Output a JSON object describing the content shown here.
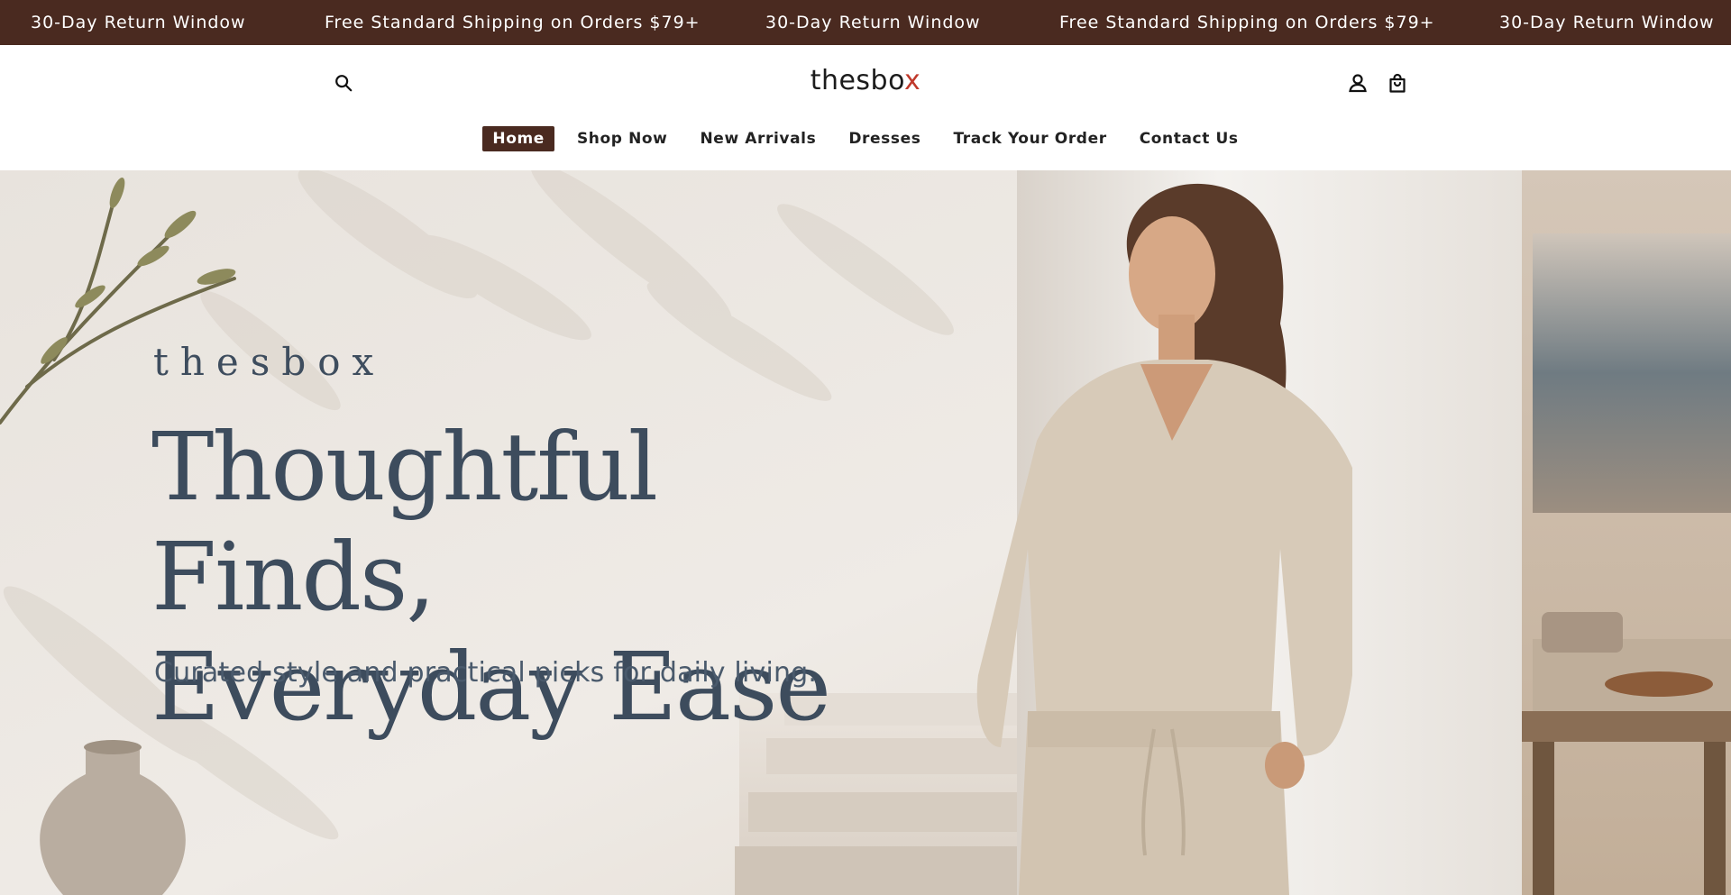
{
  "announcement": {
    "items": [
      "30-Day Return Window",
      "Free Standard Shipping on Orders $79+",
      "30-Day Return Window",
      "Free Standard Shipping on Orders $79+",
      "30-Day Return Window"
    ]
  },
  "header": {
    "logo_main": "thesbo",
    "logo_accent": "x",
    "icons": {
      "search": "search-icon",
      "account": "account-icon",
      "cart": "shopping-bag-icon"
    }
  },
  "nav": {
    "items": [
      "Home",
      "Shop Now",
      "New Arrivals",
      "Dresses",
      "Track Your Order",
      "Contact Us"
    ],
    "active": "Home"
  },
  "hero": {
    "brand": "thesbox",
    "title_line1": "Thoughtful Finds,",
    "title_line2": "Everyday Ease",
    "subtitle": "Curated style and practical picks for daily living."
  },
  "colors": {
    "brand_brown": "#4a2a20",
    "hero_text": "#3d4c5d",
    "logo_accent": "#c0392b"
  }
}
